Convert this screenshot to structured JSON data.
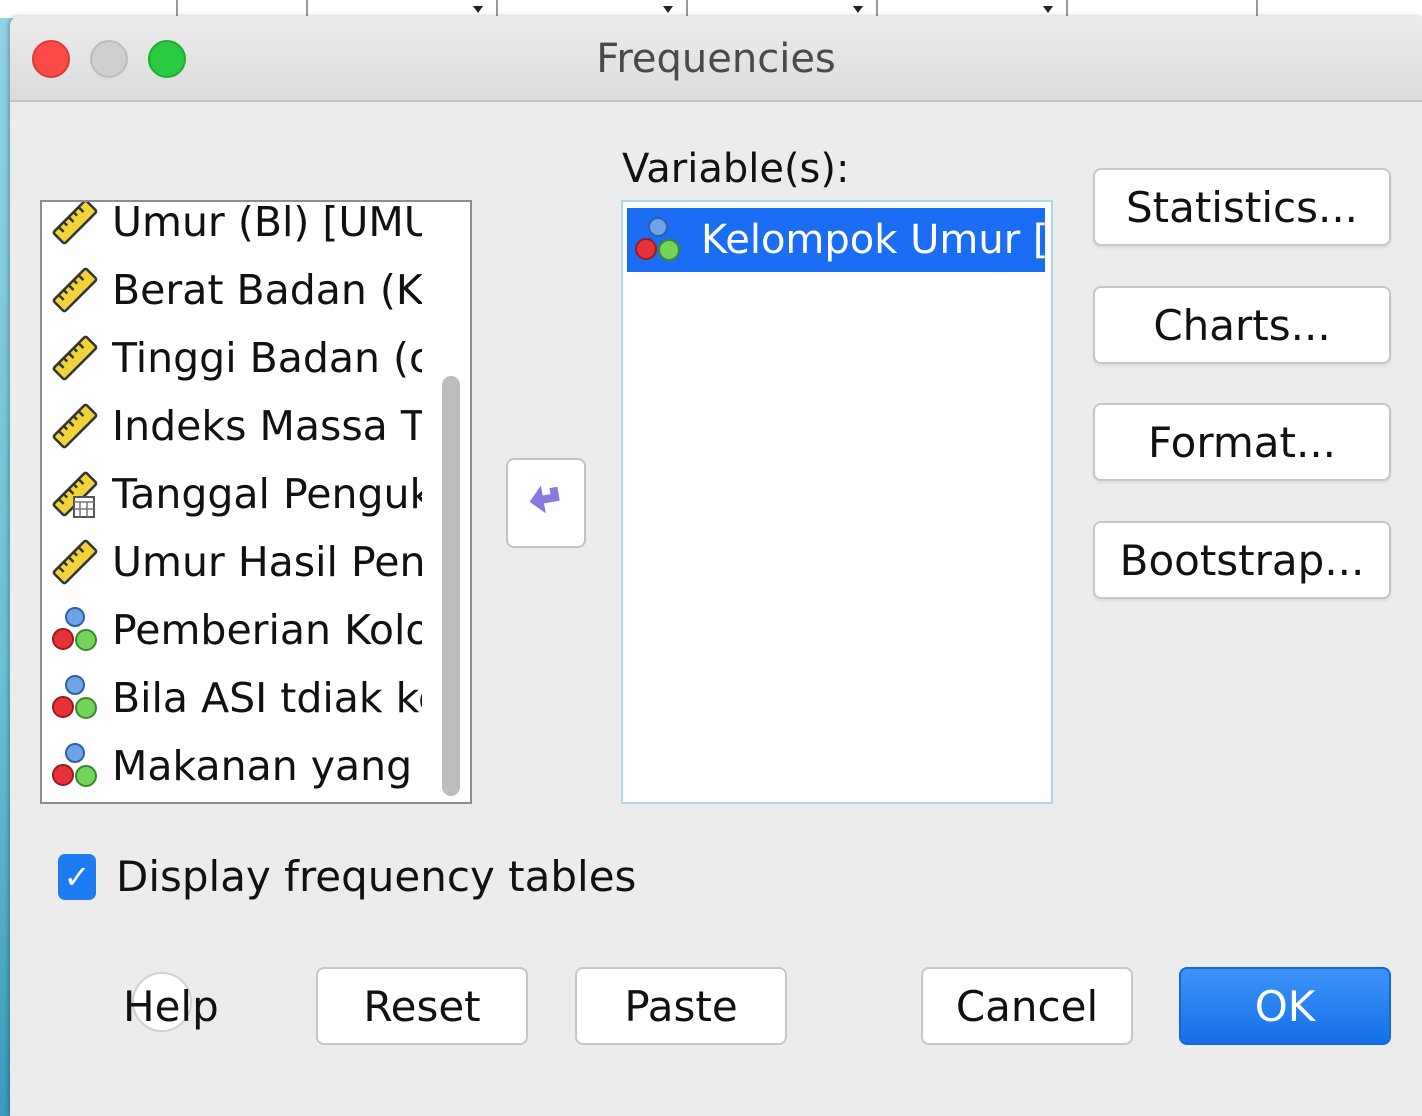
{
  "window": {
    "title": "Frequencies"
  },
  "source_list": {
    "items": [
      {
        "label": "Umur (Bl) [UMUR...",
        "icon": "scale-ruler-icon"
      },
      {
        "label": "Berat Badan (Kg...",
        "icon": "scale-ruler-icon"
      },
      {
        "label": "Tinggi Badan (c...",
        "icon": "scale-ruler-icon"
      },
      {
        "label": "Indeks Massa T...",
        "icon": "scale-ruler-icon"
      },
      {
        "label": "Tanggal Penguk...",
        "icon": "date-ruler-icon"
      },
      {
        "label": "Umur Hasil Peng...",
        "icon": "scale-ruler-icon"
      },
      {
        "label": "Pemberian Kolo...",
        "icon": "nominal-icon"
      },
      {
        "label": "Bila ASI tdiak kel...",
        "icon": "nominal-icon"
      },
      {
        "label": "Makanan yang p...",
        "icon": "nominal-icon"
      }
    ]
  },
  "target": {
    "label": "Variable(s):",
    "items": [
      {
        "label": "Kelompok Umur [K...",
        "icon": "nominal-icon"
      }
    ]
  },
  "move_button": {
    "icon": "arrow-left-icon"
  },
  "side_buttons": {
    "statistics": "Statistics...",
    "charts": "Charts...",
    "format": "Format...",
    "bootstrap": "Bootstrap..."
  },
  "options": {
    "display_frequency_tables": {
      "label": "Display frequency tables",
      "checked": true
    }
  },
  "footer": {
    "help": "Help",
    "reset": "Reset",
    "paste": "Paste",
    "cancel": "Cancel",
    "ok": "OK"
  },
  "colors": {
    "accent": "#1b6ef3",
    "ok_button": "#1470ea"
  }
}
